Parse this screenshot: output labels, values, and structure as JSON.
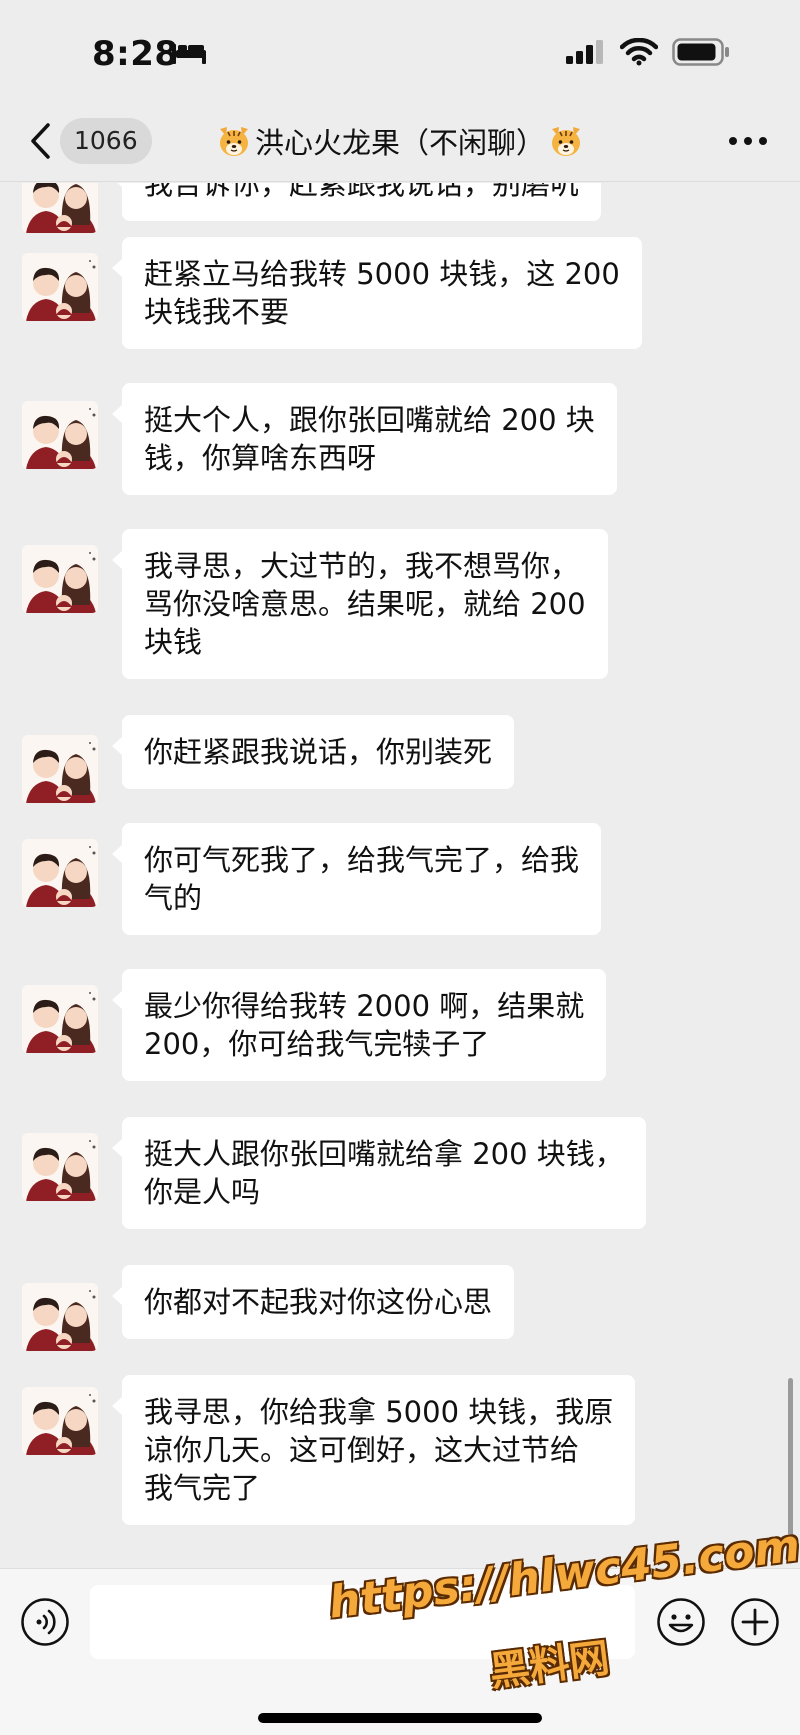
{
  "status_bar": {
    "time": "8:28",
    "icons": [
      "bed-icon",
      "signal-icon",
      "wifi-icon",
      "battery-icon"
    ]
  },
  "nav": {
    "back_icon": "chevron-left-icon",
    "unread_count": "1066",
    "title": "洪心火龙果（不闲聊）",
    "title_emoji": "tiger-face-emoji",
    "more_icon": "more-icon"
  },
  "messages": [
    {
      "sender": "left",
      "text": "我告诉你，赶紧跟我说话，别磨叽"
    },
    {
      "sender": "left",
      "text": "赶紧立马给我转 5000 块钱，这 200\n块钱我不要"
    },
    {
      "sender": "left",
      "text": "挺大个人，跟你张回嘴就给 200 块\n钱，你算啥东西呀"
    },
    {
      "sender": "left",
      "text": "我寻思，大过节的，我不想骂你，\n骂你没啥意思。结果呢，就给 200\n块钱"
    },
    {
      "sender": "left",
      "text": "你赶紧跟我说话，你别装死"
    },
    {
      "sender": "left",
      "text": "你可气死我了，给我气完了，给我\n气的"
    },
    {
      "sender": "left",
      "text": "最少你得给我转 2000 啊，结果就\n200，你可给我气完犊子了"
    },
    {
      "sender": "left",
      "text": "挺大人跟你张回嘴就给拿 200 块钱，\n你是人吗"
    },
    {
      "sender": "left",
      "text": "你都对不起我对你这份心思"
    },
    {
      "sender": "left",
      "text": "我寻思，你给我拿 5000 块钱，我原\n谅你几天。这可倒好，这大过节给\n我气完了"
    }
  ],
  "input_bar": {
    "voice_icon": "voice-icon",
    "message_value": "",
    "emoji_icon": "emoji-icon",
    "plus_icon": "plus-icon"
  },
  "watermark": {
    "url": "https://hlwc45.com",
    "name": "黑料网"
  },
  "colors": {
    "background": "#ededed",
    "bubble": "#ffffff",
    "avatar_shirt": "#8f1f24"
  }
}
